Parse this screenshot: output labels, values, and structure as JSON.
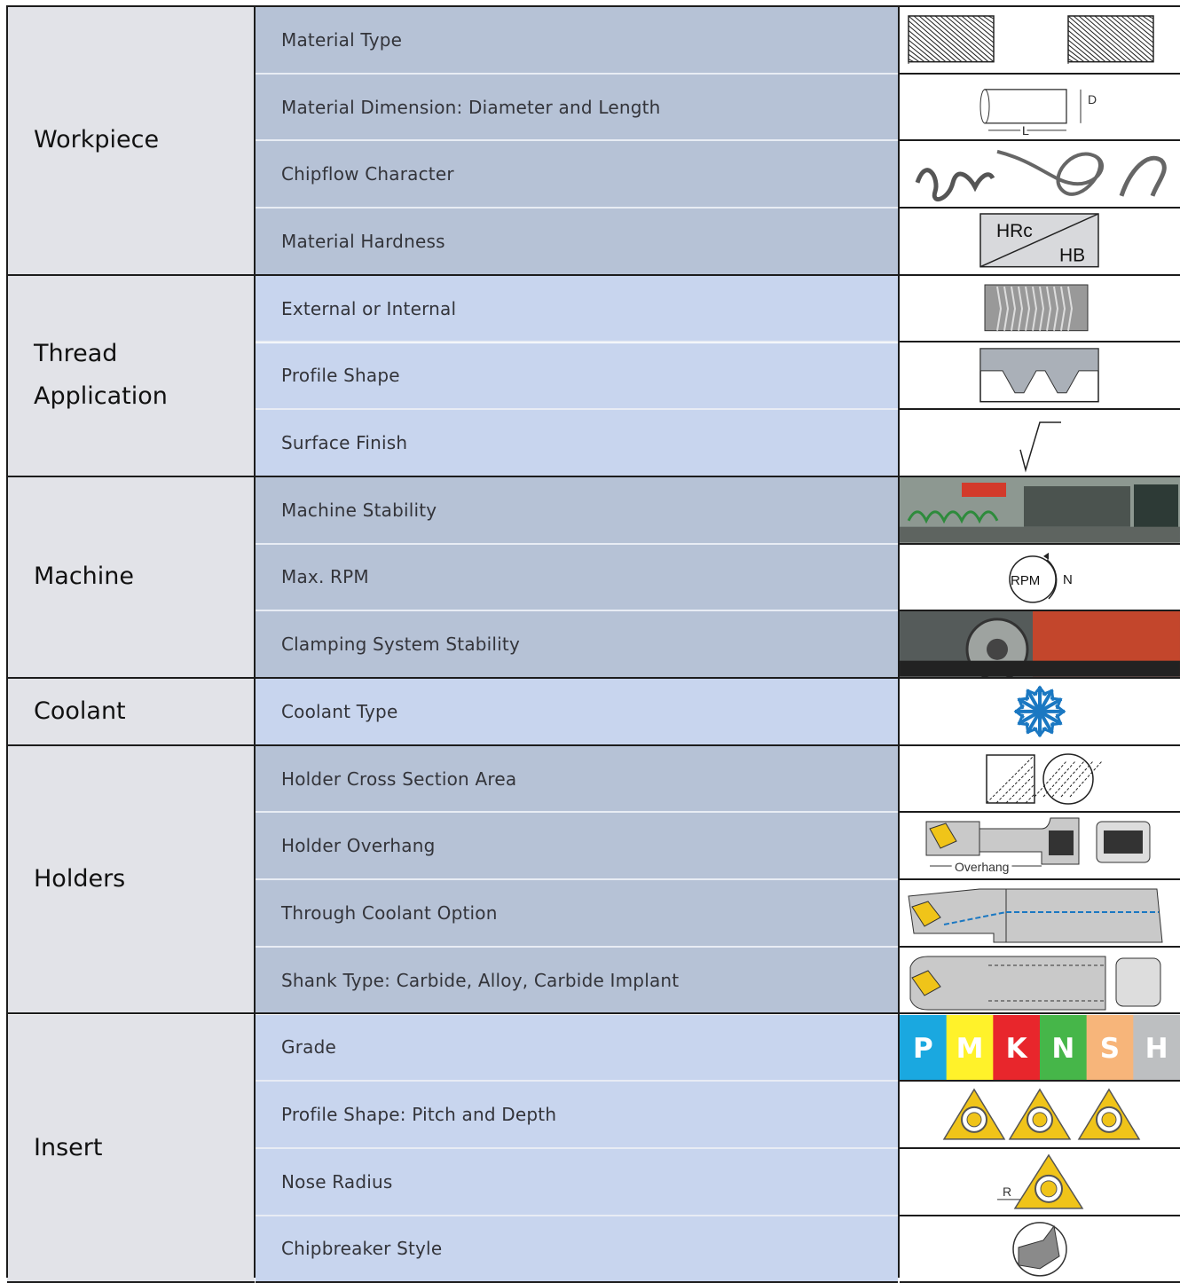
{
  "groups": [
    {
      "label": "Workpiece",
      "items": [
        {
          "label": "Material Type",
          "icon": "material-type-hatch-icon"
        },
        {
          "label": "Material Dimension: Diameter and Length",
          "icon": "diameter-length-icon",
          "icon_text": [
            "D",
            "L"
          ]
        },
        {
          "label": "Chipflow Character",
          "icon": "chip-curls-icon"
        },
        {
          "label": "Material Hardness",
          "icon": "hardness-icon",
          "icon_text": [
            "HRc",
            "HB"
          ]
        }
      ]
    },
    {
      "label": "Thread Application",
      "items": [
        {
          "label": "External or Internal",
          "icon": "thread-ext-int-icon"
        },
        {
          "label": "Profile Shape",
          "icon": "thread-profile-icon"
        },
        {
          "label": "Surface Finish",
          "icon": "surface-finish-icon"
        }
      ]
    },
    {
      "label": "Machine",
      "items": [
        {
          "label": "Machine Stability",
          "icon": "machine-photo-icon"
        },
        {
          "label": "Max. RPM",
          "icon": "rpm-icon",
          "icon_text": [
            "RPM",
            "N"
          ]
        },
        {
          "label": "Clamping System Stability",
          "icon": "chuck-photo-icon"
        }
      ]
    },
    {
      "label": "Coolant",
      "items": [
        {
          "label": "Coolant Type",
          "icon": "snowflake-icon"
        }
      ]
    },
    {
      "label": "Holders",
      "items": [
        {
          "label": "Holder Cross Section Area",
          "icon": "cross-section-icon"
        },
        {
          "label": "Holder Overhang",
          "icon": "overhang-icon",
          "icon_text": [
            "Overhang"
          ]
        },
        {
          "label": "Through Coolant Option",
          "icon": "through-coolant-icon"
        },
        {
          "label": "Shank Type: Carbide, Alloy, Carbide Implant",
          "icon": "shank-type-icon"
        }
      ]
    },
    {
      "label": "Insert",
      "items": [
        {
          "label": "Grade",
          "icon": "grade-colors-icon",
          "grades": [
            {
              "letter": "P",
              "color": "#1aa8e0"
            },
            {
              "letter": "M",
              "color": "#fff22a"
            },
            {
              "letter": "K",
              "color": "#e8262c"
            },
            {
              "letter": "N",
              "color": "#46b649"
            },
            {
              "letter": "S",
              "color": "#f7b57a"
            },
            {
              "letter": "H",
              "color": "#bdbfc1"
            }
          ]
        },
        {
          "label": "Profile Shape: Pitch and Depth",
          "icon": "insert-profiles-icon"
        },
        {
          "label": "Nose Radius",
          "icon": "nose-radius-icon",
          "icon_text": [
            "R"
          ]
        },
        {
          "label": "Chipbreaker Style",
          "icon": "chipbreaker-icon"
        }
      ]
    }
  ],
  "colors": {
    "category_bg": "#e2e3e8",
    "row_dark": "#b6c2d6",
    "row_light": "#c8d5ee",
    "snowflake": "#1b78c2",
    "insert_gold": "#f0c419"
  }
}
